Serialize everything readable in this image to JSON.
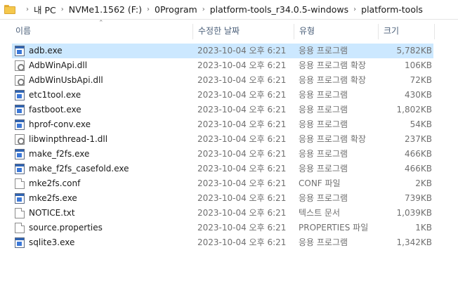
{
  "breadcrumb": {
    "items": [
      "내 PC",
      "NVMe1.1562 (F:)",
      "0Program",
      "platform-tools_r34.0.5-windows",
      "platform-tools"
    ],
    "separator": "›"
  },
  "columns": {
    "name": "이름",
    "date": "수정한 날짜",
    "type": "유형",
    "size": "크기"
  },
  "files": [
    {
      "name": "adb.exe",
      "date": "2023-10-04 오후 6:21",
      "type": "응용 프로그램",
      "size": "5,782KB",
      "icon": "exe-icon",
      "selected": true
    },
    {
      "name": "AdbWinApi.dll",
      "date": "2023-10-04 오후 6:21",
      "type": "응용 프로그램 확장",
      "size": "106KB",
      "icon": "dll-icon"
    },
    {
      "name": "AdbWinUsbApi.dll",
      "date": "2023-10-04 오후 6:21",
      "type": "응용 프로그램 확장",
      "size": "72KB",
      "icon": "dll-icon"
    },
    {
      "name": "etc1tool.exe",
      "date": "2023-10-04 오후 6:21",
      "type": "응용 프로그램",
      "size": "430KB",
      "icon": "exe-icon"
    },
    {
      "name": "fastboot.exe",
      "date": "2023-10-04 오후 6:21",
      "type": "응용 프로그램",
      "size": "1,802KB",
      "icon": "exe-icon"
    },
    {
      "name": "hprof-conv.exe",
      "date": "2023-10-04 오후 6:21",
      "type": "응용 프로그램",
      "size": "54KB",
      "icon": "exe-icon"
    },
    {
      "name": "libwinpthread-1.dll",
      "date": "2023-10-04 오후 6:21",
      "type": "응용 프로그램 확장",
      "size": "237KB",
      "icon": "dll-icon"
    },
    {
      "name": "make_f2fs.exe",
      "date": "2023-10-04 오후 6:21",
      "type": "응용 프로그램",
      "size": "466KB",
      "icon": "exe-icon"
    },
    {
      "name": "make_f2fs_casefold.exe",
      "date": "2023-10-04 오후 6:21",
      "type": "응용 프로그램",
      "size": "466KB",
      "icon": "exe-icon"
    },
    {
      "name": "mke2fs.conf",
      "date": "2023-10-04 오후 6:21",
      "type": "CONF 파일",
      "size": "2KB",
      "icon": "doc-icon"
    },
    {
      "name": "mke2fs.exe",
      "date": "2023-10-04 오후 6:21",
      "type": "응용 프로그램",
      "size": "739KB",
      "icon": "exe-icon"
    },
    {
      "name": "NOTICE.txt",
      "date": "2023-10-04 오후 6:21",
      "type": "텍스트 문서",
      "size": "1,039KB",
      "icon": "doc-icon"
    },
    {
      "name": "source.properties",
      "date": "2023-10-04 오후 6:21",
      "type": "PROPERTIES 파일",
      "size": "1KB",
      "icon": "doc-icon"
    },
    {
      "name": "sqlite3.exe",
      "date": "2023-10-04 오후 6:21",
      "type": "응용 프로그램",
      "size": "1,342KB",
      "icon": "exe-icon"
    }
  ],
  "colors": {
    "selection": "#cce8ff",
    "header_text": "#4c607a",
    "secondary_text": "#707070"
  }
}
